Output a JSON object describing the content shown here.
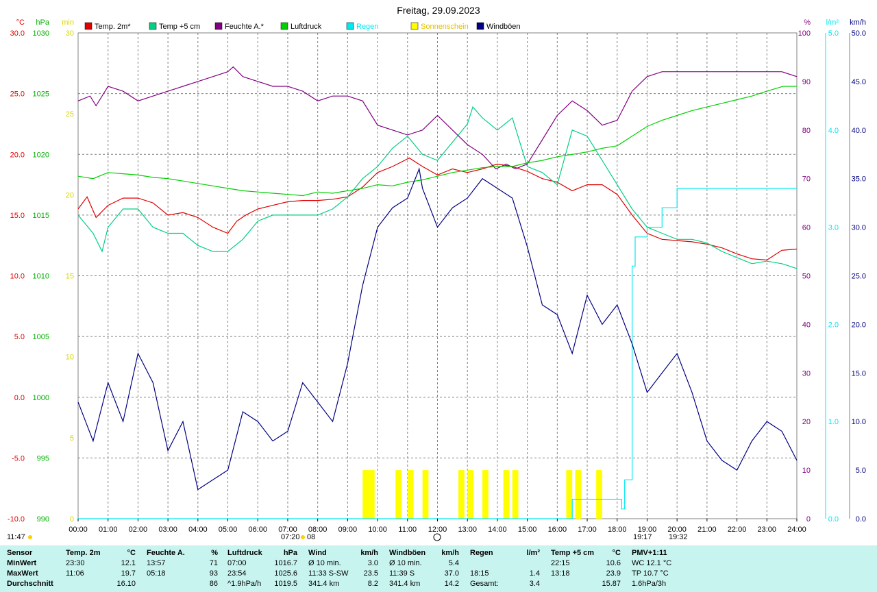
{
  "title": "Freitag, 29.09.2023",
  "colors": {
    "temp2m": "#e00000",
    "temp5cm": "#00d080",
    "feuchte": "#800080",
    "luftdruck": "#00d000",
    "regen": "#00e8f0",
    "sonne": "#ffff00",
    "wind": "#000080",
    "grid": "#808080"
  },
  "left_axes": {
    "temp": {
      "unit": "°C",
      "ticks": [
        "30.0",
        "25.0",
        "20.0",
        "15.0",
        "10.0",
        "5.0",
        "0.0",
        "-5.0",
        "-10.0"
      ],
      "color": "#e00000"
    },
    "hpa": {
      "unit": "hPa",
      "ticks": [
        "1030",
        "1025",
        "1020",
        "1015",
        "1010",
        "1005",
        "1000",
        "995",
        "990"
      ],
      "color": "#00b000"
    },
    "min": {
      "unit": "min",
      "ticks": [
        "30",
        "25",
        "20",
        "15",
        "10",
        "5",
        "0"
      ],
      "color": "#d8d800"
    }
  },
  "right_axes": {
    "pct": {
      "unit": "%",
      "ticks": [
        "100",
        "90",
        "80",
        "70",
        "60",
        "50",
        "40",
        "30",
        "20",
        "10",
        "0"
      ],
      "color": "#800080"
    },
    "rain": {
      "unit": "l/m²",
      "ticks": [
        "5.0",
        "4.0",
        "3.0",
        "2.0",
        "1.0",
        "0.0"
      ],
      "color": "#00e8f0"
    },
    "kmh": {
      "unit": "km/h",
      "ticks": [
        "50.0",
        "45.0",
        "40.0",
        "35.0",
        "30.0",
        "25.0",
        "20.0",
        "15.0",
        "10.0",
        "5.0",
        "0.0"
      ],
      "color": "#000080"
    }
  },
  "x_ticks": [
    "00:00",
    "01:00",
    "02:00",
    "03:00",
    "04:00",
    "05:00",
    "06:00",
    "07:00",
    "08:00",
    "09:00",
    "10:00",
    "11:00",
    "12:00",
    "13:00",
    "14:00",
    "15:00",
    "16:00",
    "17:00",
    "18:00",
    "19:00",
    "20:00",
    "21:00",
    "22:00",
    "23:00",
    "24:00"
  ],
  "sun_markers": {
    "sunrise": "07:20",
    "sunrise_b": "08",
    "noon": "11:47",
    "sunset": "19:17",
    "sunset_b": "19:32"
  },
  "chart_data": {
    "type": "line",
    "x_unit": "hour of day",
    "xlim": [
      0,
      24
    ],
    "series": [
      {
        "name": "Temp. 2m*",
        "unit": "°C",
        "ylim": [
          -10,
          30
        ],
        "x": [
          0,
          0.3,
          0.6,
          1,
          1.5,
          2,
          2.5,
          3,
          3.5,
          4,
          4.5,
          5,
          5.3,
          5.6,
          6,
          6.5,
          7,
          7.5,
          8,
          8.5,
          9,
          9.5,
          10,
          10.5,
          11.06,
          11.5,
          12,
          12.5,
          13,
          13.5,
          14,
          14.5,
          15,
          15.5,
          16,
          16.5,
          17,
          17.5,
          18,
          18.5,
          19,
          19.5,
          20,
          20.5,
          21,
          21.5,
          22,
          22.5,
          23,
          23.5,
          24
        ],
        "values": [
          15.5,
          16.5,
          14.8,
          15.8,
          16.4,
          16.4,
          16.0,
          15.0,
          15.2,
          14.8,
          14.0,
          13.5,
          14.5,
          15.0,
          15.5,
          15.8,
          16.1,
          16.2,
          16.2,
          16.3,
          16.5,
          17.3,
          18.5,
          19.0,
          19.7,
          19.0,
          18.3,
          18.8,
          18.5,
          18.8,
          19.2,
          19.0,
          18.6,
          18.0,
          17.7,
          17.0,
          17.5,
          17.5,
          16.7,
          15.0,
          13.5,
          13.0,
          12.9,
          12.8,
          12.6,
          12.3,
          11.8,
          11.4,
          11.3,
          12.1,
          12.2
        ]
      },
      {
        "name": "Temp +5 cm",
        "unit": "°C",
        "ylim": [
          -10,
          30
        ],
        "x": [
          0,
          0.5,
          0.8,
          1,
          1.5,
          2,
          2.5,
          3,
          3.5,
          4,
          4.5,
          5,
          5.5,
          6,
          6.5,
          7,
          7.5,
          8,
          8.5,
          9,
          9.5,
          10,
          10.5,
          11,
          11.5,
          12,
          12.5,
          13,
          13.18,
          13.5,
          14,
          14.5,
          15,
          15.5,
          16,
          16.5,
          17,
          17.5,
          18,
          18.5,
          19,
          19.5,
          20,
          20.5,
          21,
          21.5,
          22,
          22.5,
          23,
          23.5,
          24
        ],
        "values": [
          15.0,
          13.5,
          12.0,
          14.0,
          15.5,
          15.5,
          14.0,
          13.5,
          13.5,
          12.5,
          12.0,
          12.0,
          13.0,
          14.5,
          15.0,
          15.0,
          15.0,
          15.0,
          15.5,
          16.5,
          18.0,
          19.0,
          20.5,
          21.5,
          20.0,
          19.5,
          21.0,
          22.5,
          23.9,
          23.0,
          22.0,
          23.0,
          19.0,
          18.5,
          17.5,
          22.0,
          21.5,
          19.5,
          17.5,
          15.5,
          14.0,
          13.5,
          13.0,
          13.0,
          12.7,
          12.0,
          11.5,
          11.0,
          11.2,
          11.0,
          10.6
        ]
      },
      {
        "name": "Feuchte A.*",
        "unit": "%",
        "ylim": [
          0,
          100
        ],
        "x": [
          0,
          0.4,
          0.6,
          1,
          1.5,
          2,
          2.5,
          3,
          3.5,
          4,
          4.5,
          5,
          5.18,
          5.5,
          6,
          6.5,
          7,
          7.5,
          8,
          8.5,
          9,
          9.5,
          10,
          10.5,
          11,
          11.5,
          12,
          12.5,
          13,
          13.5,
          13.95,
          14.3,
          14.6,
          15,
          15.5,
          16,
          16.5,
          17,
          17.5,
          18,
          18.5,
          19,
          19.5,
          20,
          20.5,
          21,
          21.5,
          22,
          22.5,
          23,
          23.5,
          24
        ],
        "values": [
          86,
          87,
          85,
          89,
          88,
          86,
          87,
          88,
          89,
          90,
          91,
          92,
          93,
          91,
          90,
          89,
          89,
          88,
          86,
          87,
          87,
          86,
          81,
          80,
          79,
          80,
          83,
          80,
          77,
          75,
          72,
          73,
          72,
          73,
          78,
          83,
          86,
          84,
          81,
          82,
          88,
          91,
          92,
          92,
          92,
          92,
          92,
          92,
          92,
          92,
          92,
          91
        ]
      },
      {
        "name": "Luftdruck",
        "unit": "hPa",
        "ylim": [
          990,
          1030
        ],
        "x": [
          0,
          0.5,
          1,
          1.5,
          2,
          2.5,
          3,
          3.5,
          4,
          4.5,
          5,
          5.5,
          6,
          6.5,
          7,
          7.5,
          8,
          8.5,
          9,
          9.5,
          10,
          10.5,
          11,
          11.5,
          12,
          12.5,
          13,
          13.5,
          14,
          14.5,
          15,
          15.5,
          16,
          16.5,
          17,
          17.5,
          18,
          18.5,
          19,
          19.5,
          20,
          20.5,
          21,
          21.5,
          22,
          22.5,
          23,
          23.54,
          24
        ],
        "values": [
          1018.2,
          1018.0,
          1018.5,
          1018.4,
          1018.3,
          1018.1,
          1018.0,
          1017.8,
          1017.6,
          1017.4,
          1017.2,
          1017.0,
          1016.9,
          1016.8,
          1016.7,
          1016.6,
          1016.9,
          1016.8,
          1017.0,
          1017.2,
          1017.5,
          1017.4,
          1017.7,
          1017.9,
          1018.2,
          1018.5,
          1018.7,
          1018.9,
          1019.0,
          1019.0,
          1019.3,
          1019.5,
          1019.8,
          1020.0,
          1020.2,
          1020.5,
          1020.7,
          1021.5,
          1022.3,
          1022.8,
          1023.2,
          1023.6,
          1023.9,
          1024.2,
          1024.5,
          1024.8,
          1025.2,
          1025.6,
          1025.6
        ]
      },
      {
        "name": "Regen",
        "unit": "l/m²",
        "ylim": [
          0,
          5
        ],
        "x": [
          0,
          16.4,
          16.5,
          17.0,
          17.5,
          18.0,
          18.15,
          18.25,
          18.5,
          18.6,
          19.0,
          19.5,
          20.0,
          20.5,
          24
        ],
        "values": [
          0,
          0,
          0.2,
          0.2,
          0.2,
          0.2,
          0.1,
          0.4,
          2.6,
          2.9,
          3.0,
          3.2,
          3.4,
          3.4,
          3.4
        ]
      },
      {
        "name": "Sonnenschein",
        "unit": "min",
        "ylim": [
          0,
          30
        ],
        "x": [
          9.5,
          9.7,
          10.6,
          11.0,
          11.5,
          12.7,
          13.0,
          13.5,
          14.2,
          14.5,
          16.3,
          16.6,
          17.3
        ],
        "values": [
          3,
          3,
          3,
          3,
          3,
          3,
          3,
          3,
          3,
          3,
          3,
          3,
          3
        ]
      },
      {
        "name": "Windböen",
        "unit": "km/h",
        "ylim": [
          0,
          50
        ],
        "x": [
          0,
          0.5,
          1,
          1.5,
          2,
          2.5,
          3,
          3.5,
          4,
          4.5,
          5,
          5.5,
          6,
          6.5,
          7,
          7.5,
          8,
          8.5,
          9,
          9.5,
          10,
          10.5,
          11,
          11.39,
          11.5,
          12,
          12.5,
          13,
          13.5,
          14,
          14.5,
          15,
          15.5,
          16,
          16.5,
          17,
          17.5,
          18,
          18.5,
          19,
          19.5,
          20,
          20.5,
          21,
          21.5,
          22,
          22.5,
          23,
          23.5,
          24
        ],
        "values": [
          12,
          8,
          14,
          10,
          17,
          14,
          7,
          10,
          3,
          4,
          5,
          11,
          10,
          8,
          9,
          14,
          12,
          10,
          16,
          24,
          30,
          32,
          33,
          36,
          34,
          30,
          32,
          33,
          35,
          34,
          33,
          28,
          22,
          21,
          17,
          23,
          20,
          22,
          18,
          13,
          15,
          17,
          13,
          8,
          6,
          5,
          8,
          10,
          9,
          6
        ]
      }
    ],
    "stats": {
      "headers": [
        "Sensor",
        "Temp. 2m",
        "°C",
        "Feuchte A.",
        "%",
        "Luftdruck",
        "hPa",
        "Wind",
        "km/h",
        "Windböen",
        "km/h",
        "Regen",
        "l/m²",
        "Temp +5 cm",
        "°C",
        "PMV+1:11"
      ],
      "rows": [
        {
          "label": "MinWert",
          "t2_time": "23:30",
          "t2_val": "12.1",
          "f_time": "13:57",
          "f_val": "71",
          "p_time": "07:00",
          "p_val": "1016.7",
          "w_lab": "Ø 10 min.",
          "w_val": "3.0",
          "g_lab": "Ø 10 min.",
          "g_val": "5.4",
          "r_time": "",
          "r_val": "",
          "t5_time": "22:15",
          "t5_val": "10.6",
          "pmv": "WC 12.1 °C"
        },
        {
          "label": "MaxWert",
          "t2_time": "11:06",
          "t2_val": "19.7",
          "f_time": "05:18",
          "f_val": "93",
          "p_time": "23:54",
          "p_val": "1025.6",
          "w_lab": "11:33",
          "w_dir": "S-SW",
          "w_val": "23.5",
          "g_lab": "11:39",
          "g_dir": "S",
          "g_val": "37.0",
          "r_time": "18:15",
          "r_val": "1.4",
          "t5_time": "13:18",
          "t5_val": "23.9",
          "pmv": "TP 10.7 °C"
        },
        {
          "label": "Durchschnitt",
          "t2_time": "",
          "t2_val": "16.10",
          "f_time": "",
          "f_val": "86",
          "p_time": "^1.9hPa/h",
          "p_val": "1019.5",
          "w_lab": "341.4 km",
          "w_val": "8.2",
          "g_lab": "341.4 km",
          "g_val": "14.2",
          "r_time": "Gesamt:",
          "r_val": "3.4",
          "t5_time": "",
          "t5_val": "15.87",
          "pmv": "1.6hPa/3h"
        }
      ]
    }
  }
}
